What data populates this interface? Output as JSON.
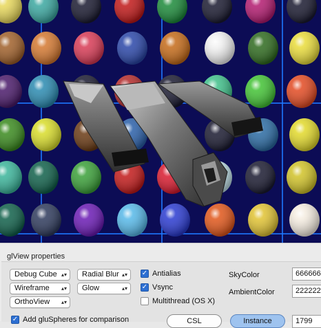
{
  "panel": {
    "title": "glView properties",
    "debug_cube": "Debug Cube",
    "wireframe": "Wireframe",
    "orthoview": "OrthoView",
    "radial_blur": "Radial Blur",
    "glow": "Glow",
    "popup_arrows": "▴▾",
    "antialias": {
      "label": "Antialias",
      "checked": true
    },
    "vsync": {
      "label": "Vsync",
      "checked": true
    },
    "multithread": {
      "label": "Multithread (OS X)",
      "checked": false
    },
    "add_glu": {
      "label": "Add gluSpheres for comparison",
      "checked": true
    },
    "sky_color_label": "SkyColor",
    "sky_color_value": "666666",
    "ambient_color_label": "AmbientColor",
    "ambient_color_value": "222222",
    "csl_button": "CSL",
    "instance_button": "Instance",
    "instance_count": "1799"
  },
  "viewport": {
    "background": "#0c0c55",
    "grid_line_color": "#1e78ff",
    "ball_colors": [
      [
        "#e8d85a",
        "#3aa7a0",
        "#1a1a30",
        "#c01818",
        "#1c8a3a",
        "#1a1a30",
        "#b21a6f",
        "#1a1a30"
      ],
      [
        "#a0602a",
        "#d47830",
        "#d83a55",
        "#2a46a8",
        "#c46a18",
        "#f1f1f1",
        "#2e6a1e",
        "#e9dc3a"
      ],
      [
        "#4a1a6a",
        "#2a8ab0",
        "#1a1a30",
        "#b22a2a",
        "#1a1a30",
        "#3fc08a",
        "#42c234",
        "#e24a22"
      ],
      [
        "#3a8a1e",
        "#d8dc2a",
        "#6a3a14",
        "#2a5fa8",
        "#4a9ad0",
        "#1a1a30",
        "#2a6aa2",
        "#e1d82a"
      ],
      [
        "#3ab49a",
        "#10604a",
        "#3aa038",
        "#c21a1a",
        "#d81a2e",
        "#c0e0e8",
        "#1a1a30",
        "#d0c228"
      ],
      [
        "#10604a",
        "#2e3a5c",
        "#6a1ab4",
        "#56b8e8",
        "#2a3ad0",
        "#e0561a",
        "#e0c232",
        "#f4ece0"
      ]
    ]
  }
}
